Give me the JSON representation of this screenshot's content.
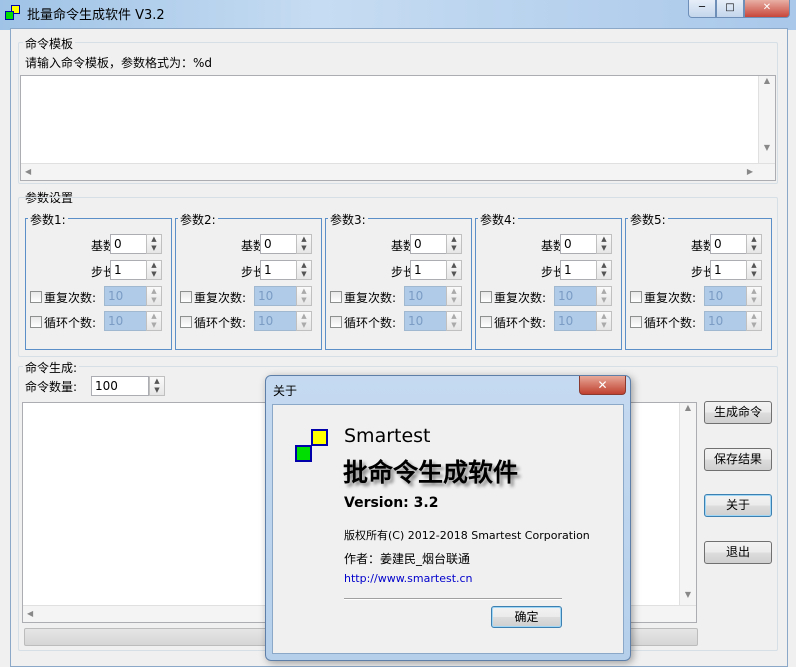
{
  "window": {
    "title": "批量命令生成软件 V3.2",
    "min": "─",
    "max": "□",
    "close": "✕"
  },
  "template": {
    "group_label": "命令模板",
    "hint": "请输入命令模板，参数格式为：%d",
    "value": ""
  },
  "params": {
    "group_label": "参数设置",
    "base_label": "基数:",
    "step_label": "步长:",
    "repeat_label": "重复次数:",
    "loop_label": "循环个数:",
    "items": [
      {
        "label": "参数1:",
        "base": "0",
        "step": "1",
        "repeat": "10",
        "loop": "10"
      },
      {
        "label": "参数2:",
        "base": "0",
        "step": "1",
        "repeat": "10",
        "loop": "10"
      },
      {
        "label": "参数3:",
        "base": "0",
        "step": "1",
        "repeat": "10",
        "loop": "10"
      },
      {
        "label": "参数4:",
        "base": "0",
        "step": "1",
        "repeat": "10",
        "loop": "10"
      },
      {
        "label": "参数5:",
        "base": "0",
        "step": "1",
        "repeat": "10",
        "loop": "10"
      }
    ]
  },
  "generate": {
    "group_label": "命令生成:",
    "count_label": "命令数量:",
    "count": "100",
    "output": "",
    "progress": 0,
    "buttons": {
      "generate": "生成命令",
      "save": "保存结果",
      "about": "关于",
      "exit": "退出"
    }
  },
  "about": {
    "title": "关于",
    "close": "✕",
    "brand": "Smartest",
    "product": "批命令生成软件",
    "version": "Version: 3.2",
    "copyright": "版权所有(C) 2012-2018  Smartest Corporation",
    "author": "作者：姜建民_烟台联通",
    "url": "http://www.smartest.cn",
    "ok": "确定",
    "link_color": "#0000cc"
  }
}
